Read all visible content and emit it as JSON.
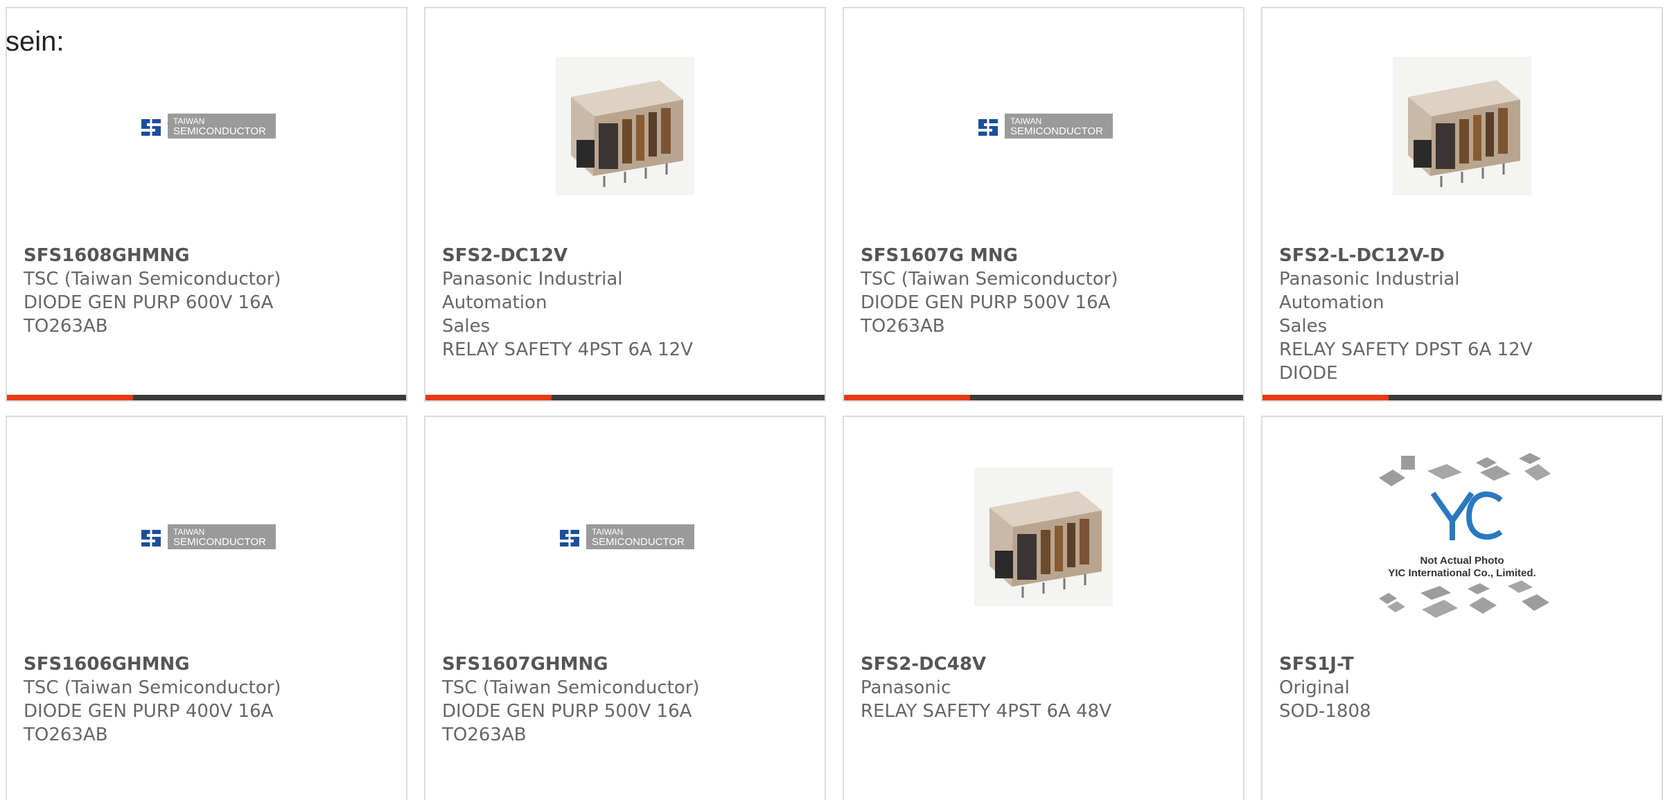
{
  "intro_text": "sein:",
  "brand_colors": {
    "accent": "#e8380d",
    "bar": "#3b3b3b",
    "border": "#dcdcdc"
  },
  "logo_text": {
    "tsc_line1": "TAIWAN",
    "tsc_line2": "SEMICONDUCTOR",
    "yic_line1": "Not Actual Photo",
    "yic_line2": "YIC International Co., Limited."
  },
  "products": [
    {
      "part": "SFS1608GHMNG",
      "lines": [
        "TSC (Taiwan Semiconductor)",
        "DIODE GEN PURP 600V 16A",
        "TO263AB"
      ],
      "image": "tsc-logo"
    },
    {
      "part": "SFS2-DC12V",
      "lines": [
        "Panasonic Industrial Automation",
        "Sales",
        "RELAY SAFETY 4PST 6A 12V"
      ],
      "image": "relay-photo"
    },
    {
      "part": "SFS1607G MNG",
      "lines": [
        "TSC (Taiwan Semiconductor)",
        "DIODE GEN PURP 500V 16A",
        "TO263AB"
      ],
      "image": "tsc-logo"
    },
    {
      "part": "SFS2-L-DC12V-D",
      "lines": [
        "Panasonic Industrial Automation",
        "Sales",
        "RELAY SAFETY DPST 6A 12V",
        "DIODE"
      ],
      "image": "relay-photo"
    },
    {
      "part": "SFS1606GHMNG",
      "lines": [
        "TSC (Taiwan Semiconductor)",
        "DIODE GEN PURP 400V 16A",
        "TO263AB"
      ],
      "image": "tsc-logo"
    },
    {
      "part": "SFS1607GHMNG",
      "lines": [
        "TSC (Taiwan Semiconductor)",
        "DIODE GEN PURP 500V 16A",
        "TO263AB"
      ],
      "image": "tsc-logo"
    },
    {
      "part": "SFS2-DC48V",
      "lines": [
        "Panasonic",
        "RELAY SAFETY 4PST 6A 48V"
      ],
      "image": "relay-photo"
    },
    {
      "part": "SFS1J-T",
      "lines": [
        "Original",
        "SOD-1808"
      ],
      "image": "yic-placeholder"
    }
  ]
}
